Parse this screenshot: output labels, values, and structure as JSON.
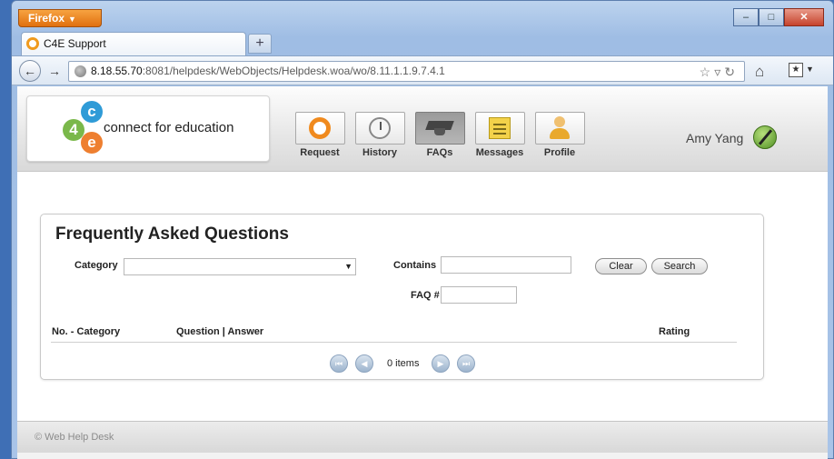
{
  "browser": {
    "menu_label": "Firefox",
    "tab_title": "C4E Support",
    "new_tab_symbol": "+",
    "url_host": "8.18.55.70",
    "url_rest": ":8081/helpdesk/WebObjects/Helpdesk.woa/wo/8.11.1.1.9.7.4.1",
    "icons": [
      "back-arrow-icon",
      "forward-arrow-icon",
      "globe-icon",
      "star-icon",
      "reload-icon",
      "home-icon",
      "bookmark-icon"
    ]
  },
  "header": {
    "logo_text": "connect for education",
    "logo_letters": [
      "c",
      "4",
      "e"
    ],
    "nav": [
      {
        "label": "Request"
      },
      {
        "label": "History"
      },
      {
        "label": "FAQs"
      },
      {
        "label": "Messages"
      },
      {
        "label": "Profile"
      }
    ],
    "active_nav": "FAQs",
    "user_name": "Amy Yang"
  },
  "faq": {
    "title": "Frequently Asked Questions",
    "category_label": "Category",
    "category_value": "",
    "contains_label": "Contains",
    "contains_value": "",
    "faq_no_label": "FAQ #",
    "faq_no_value": "",
    "clear_label": "Clear",
    "search_label": "Search",
    "columns": [
      "No. - Category",
      "Question | Answer",
      "Rating"
    ],
    "pager_text": "0 items"
  },
  "footer": {
    "text": "© Web Help Desk"
  },
  "colors": {
    "accent_orange": "#f08a1e",
    "logo_blue": "#2f9bd7",
    "logo_green": "#7ab84a",
    "logo_orange": "#ee7f30"
  }
}
